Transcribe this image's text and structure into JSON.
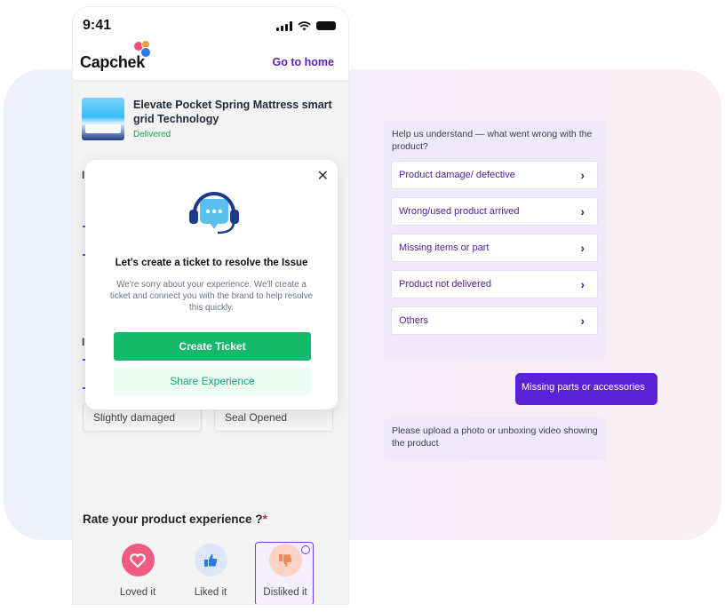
{
  "status_bar": {
    "time": "9:41"
  },
  "header": {
    "logo": "Capchek",
    "go_home": "Go to home"
  },
  "product": {
    "title": "Elevate Pocket Spring Mattress smart grid Technology",
    "status": "Delivered"
  },
  "chips": [
    "Slightly damaged",
    "Seal Opened"
  ],
  "rating": {
    "title": "Rate your product experience ?",
    "required_mark": "*",
    "options": [
      {
        "label": "Loved it",
        "icon": "heart-icon",
        "color": "#ef4f79"
      },
      {
        "label": "Liked it",
        "icon": "thumbs-up-icon",
        "color": "#2c7be5"
      },
      {
        "label": "Disliked it",
        "icon": "thumbs-down-icon",
        "color": "#f08a5d",
        "selected": true
      }
    ]
  },
  "modal": {
    "icon": "support-headset-icon",
    "title": "Let's create a ticket to resolve the Issue",
    "body": "We're sorry about your experience. We'll create a ticket and connect you with the brand to help resolve this quickly.",
    "primary_button": "Create Ticket",
    "secondary_button": "Share Experience"
  },
  "chat": {
    "question": "Help us understand — what went wrong with the product?",
    "options": [
      "Product damage/ defective",
      "Wrong/used product arrived",
      "Missing items or part",
      "Product not delivered",
      "Others"
    ],
    "reply": "Missing parts or accessories",
    "followup": "Please upload a photo or  unboxing video showing the product"
  },
  "colors": {
    "accent_purple": "#5b21d6",
    "success_green": "#16b86b"
  }
}
